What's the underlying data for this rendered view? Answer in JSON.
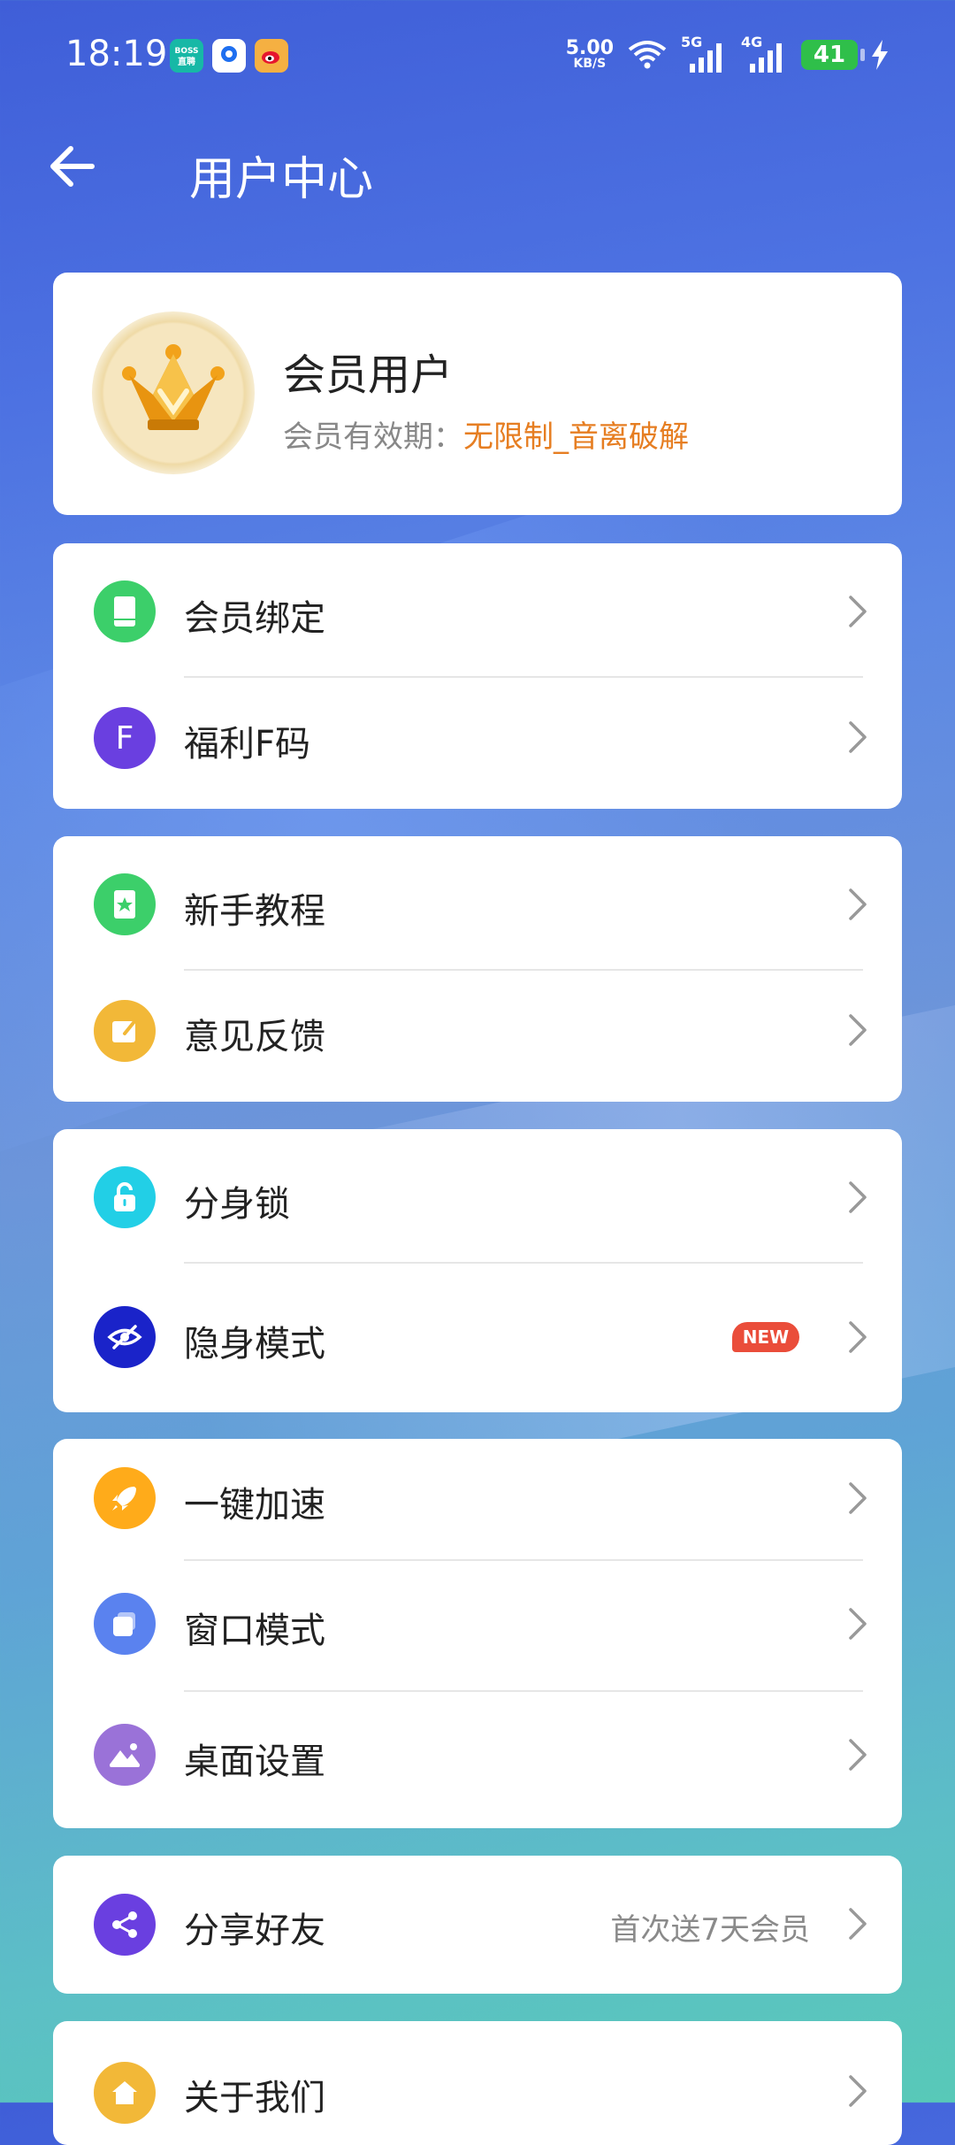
{
  "status_bar": {
    "time": "18:19",
    "apps": [
      {
        "name": "boss-zhipin-icon",
        "label": "BOSS\n直聘",
        "color": "#17b8a6"
      },
      {
        "name": "news-app-icon",
        "label": "",
        "color": "#1e6ff0"
      },
      {
        "name": "weibo-icon",
        "label": "",
        "color": "#f5b042"
      }
    ],
    "net_speed": "5.00",
    "net_speed_unit": "KB/S",
    "signal_1": "5G",
    "signal_2": "4G",
    "battery": "41"
  },
  "header": {
    "title": "用户中心"
  },
  "profile": {
    "name": "会员用户",
    "expiry_label": "会员有效期：",
    "expiry_value": "无限制_音离破解"
  },
  "groups": [
    [
      {
        "name": "member-bind",
        "label": "会员绑定",
        "icon": "phone-icon",
        "color": "#3ccf6a"
      },
      {
        "name": "fcode",
        "label": "福利F码",
        "icon": "f-letter-icon",
        "color": "#6a3fe0"
      }
    ],
    [
      {
        "name": "tutorial",
        "label": "新手教程",
        "icon": "book-star-icon",
        "color": "#3ccf6a"
      },
      {
        "name": "feedback",
        "label": "意见反馈",
        "icon": "edit-icon",
        "color": "#f2b838"
      }
    ],
    [
      {
        "name": "clone-lock",
        "label": "分身锁",
        "icon": "lock-icon",
        "color": "#22cfe6"
      },
      {
        "name": "stealth-mode",
        "label": "隐身模式",
        "icon": "eye-off-icon",
        "color": "#1a23c9",
        "badge": "NEW"
      }
    ],
    [
      {
        "name": "boost",
        "label": "一键加速",
        "icon": "rocket-icon",
        "color": "#ffab1a"
      },
      {
        "name": "window-mode",
        "label": "窗口模式",
        "icon": "window-icon",
        "color": "#5a82ef"
      },
      {
        "name": "desktop-settings",
        "label": "桌面设置",
        "icon": "landscape-icon",
        "color": "#9a72d8"
      }
    ],
    [
      {
        "name": "share",
        "label": "分享好友",
        "icon": "share-icon",
        "color": "#6a3fe0",
        "extra": "首次送7天会员"
      }
    ],
    [
      {
        "name": "about",
        "label": "关于我们",
        "icon": "home-icon",
        "color": "#f2b838"
      }
    ]
  ]
}
